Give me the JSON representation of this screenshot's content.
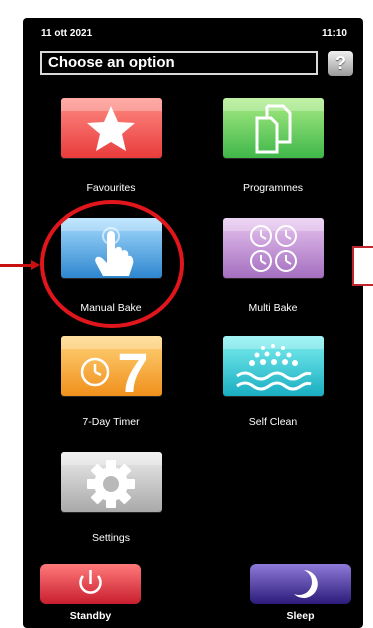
{
  "status": {
    "date": "11 ott 2021",
    "time": "11:10"
  },
  "header": {
    "prompt": "Choose an option",
    "help_label": "?"
  },
  "menu": {
    "favourites": "Favourites",
    "programmes": "Programmes",
    "manual_bake": "Manual Bake",
    "multi_bake": "Multi Bake",
    "timer_label": "7-Day Timer",
    "timer_digit": "7",
    "self_clean": "Self Clean",
    "settings": "Settings"
  },
  "bottom": {
    "standby": "Standby",
    "sleep": "Sleep"
  },
  "colors": {
    "favourites": "#e83c3c",
    "programmes": "#3fb74a",
    "manual_bake": "#2e87cf",
    "multi_bake": "#a56fc0",
    "timer": "#f0901c",
    "self_clean": "#19aec2",
    "settings": "#a9a9a9",
    "annotation": "#e0161c"
  },
  "icons": {
    "favourites": "star-icon",
    "programmes": "documents-icon",
    "manual_bake": "hand-pointer-icon",
    "multi_bake": "clocks-icon",
    "timer": "clock-seven-icon",
    "self_clean": "water-spray-icon",
    "settings": "gear-icon",
    "standby": "power-icon",
    "sleep": "moon-icon"
  }
}
